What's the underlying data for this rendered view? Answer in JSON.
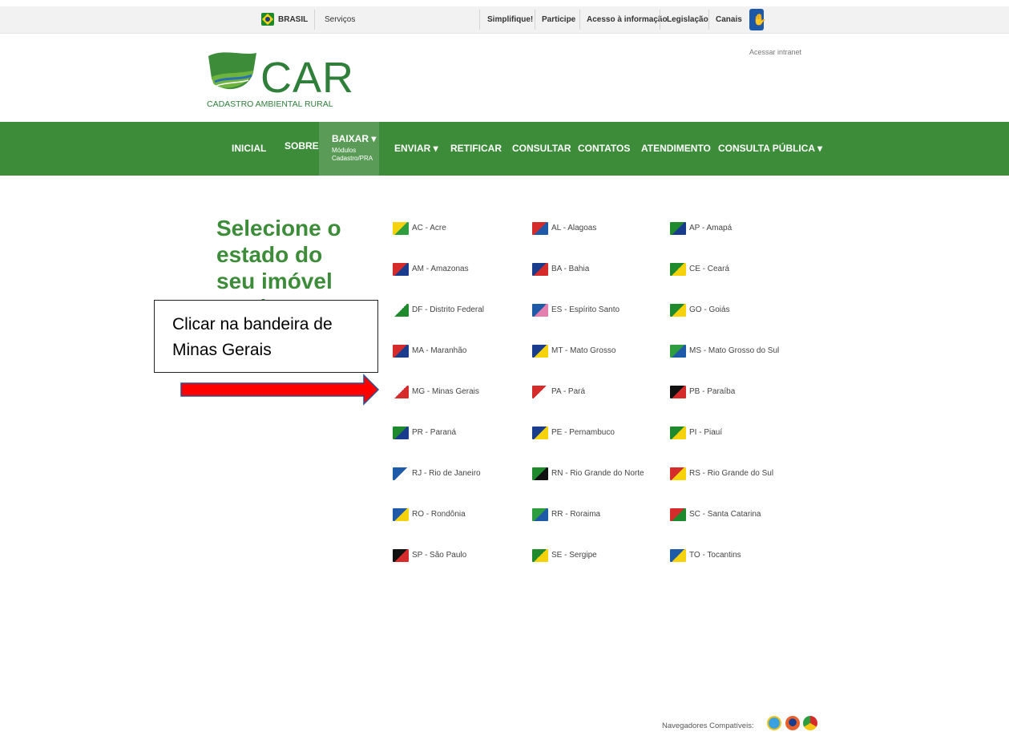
{
  "govbar": {
    "brasil": "BRASIL",
    "servicos": "Serviços",
    "links": [
      "Simplifique!",
      "Participe",
      "Acesso à informação",
      "Legislação",
      "Canais"
    ]
  },
  "header": {
    "logo_text": "CAR",
    "logo_subtitle": "CADASTRO AMBIENTAL RURAL",
    "intranet": "Acessar intranet"
  },
  "nav": {
    "inicial": "INICIAL",
    "sobre": "SOBRE",
    "baixar": "BAIXAR ▾",
    "baixar_sub": "Módulos Cadastro/PRA",
    "enviar": "ENVIAR ▾",
    "retificar": "RETIFICAR",
    "consultar": "CONSULTAR",
    "contatos": "CONTATOS",
    "atendimento": "ATENDIMENTO",
    "consulta_publica": "CONSULTA PÚBLICA ▾"
  },
  "page_title": "Selecione o estado do seu imóvel rural:",
  "states": [
    {
      "label": "AC - Acre",
      "color": "#f5d20b",
      "accent": "#2e9d3e"
    },
    {
      "label": "AL - Alagoas",
      "color": "#d62b2b",
      "accent": "#1e5aa8"
    },
    {
      "label": "AP - Amapá",
      "color": "#1e8a2d",
      "accent": "#1a3c8c"
    },
    {
      "label": "AM - Amazonas",
      "color": "#d62b2b",
      "accent": "#1a3c8c"
    },
    {
      "label": "BA - Bahia",
      "color": "#1a3c8c",
      "accent": "#d62b2b"
    },
    {
      "label": "CE - Ceará",
      "color": "#1e8a2d",
      "accent": "#f5d20b"
    },
    {
      "label": "DF - Distrito Federal",
      "color": "#ffffff",
      "accent": "#1e8a2d"
    },
    {
      "label": "ES - Espírito Santo",
      "color": "#1e5aa8",
      "accent": "#e57fb0"
    },
    {
      "label": "GO - Goiás",
      "color": "#1e8a2d",
      "accent": "#f5d20b"
    },
    {
      "label": "MA - Maranhão",
      "color": "#d62b2b",
      "accent": "#1a3c8c"
    },
    {
      "label": "MT - Mato Grosso",
      "color": "#1a3c8c",
      "accent": "#f5d20b"
    },
    {
      "label": "MS - Mato Grosso do Sul",
      "color": "#2e9d3e",
      "accent": "#1e5aa8"
    },
    {
      "label": "MG - Minas Gerais",
      "color": "#ffffff",
      "accent": "#d62b2b"
    },
    {
      "label": "PA - Pará",
      "color": "#d62b2b",
      "accent": "#ffffff"
    },
    {
      "label": "PB - Paraíba",
      "color": "#111111",
      "accent": "#d62b2b"
    },
    {
      "label": "PR - Paraná",
      "color": "#1e8a2d",
      "accent": "#1a3c8c"
    },
    {
      "label": "PE - Pernambuco",
      "color": "#1a3c8c",
      "accent": "#f5d20b"
    },
    {
      "label": "PI - Piauí",
      "color": "#1e8a2d",
      "accent": "#f5d20b"
    },
    {
      "label": "RJ - Rio de Janeiro",
      "color": "#1e5aa8",
      "accent": "#ffffff"
    },
    {
      "label": "RN - Rio Grande do Norte",
      "color": "#1e8a2d",
      "accent": "#111111"
    },
    {
      "label": "RS - Rio Grande do Sul",
      "color": "#d62b2b",
      "accent": "#f5d20b"
    },
    {
      "label": "RO - Rondônia",
      "color": "#1e5aa8",
      "accent": "#f5d20b"
    },
    {
      "label": "RR - Roraima",
      "color": "#2e9d3e",
      "accent": "#1e5aa8"
    },
    {
      "label": "SC - Santa Catarina",
      "color": "#d62b2b",
      "accent": "#1e8a2d"
    },
    {
      "label": "SP - São Paulo",
      "color": "#111111",
      "accent": "#d62b2b"
    },
    {
      "label": "SE - Sergipe",
      "color": "#1e8a2d",
      "accent": "#f5d20b"
    },
    {
      "label": "TO - Tocantins",
      "color": "#1e5aa8",
      "accent": "#f5d20b"
    }
  ],
  "callout": {
    "text": "Clicar na bandeira de Minas Gerais",
    "arrow_color": "#ff0000"
  },
  "footer": {
    "label": "Navegadores Compatíveis:"
  }
}
